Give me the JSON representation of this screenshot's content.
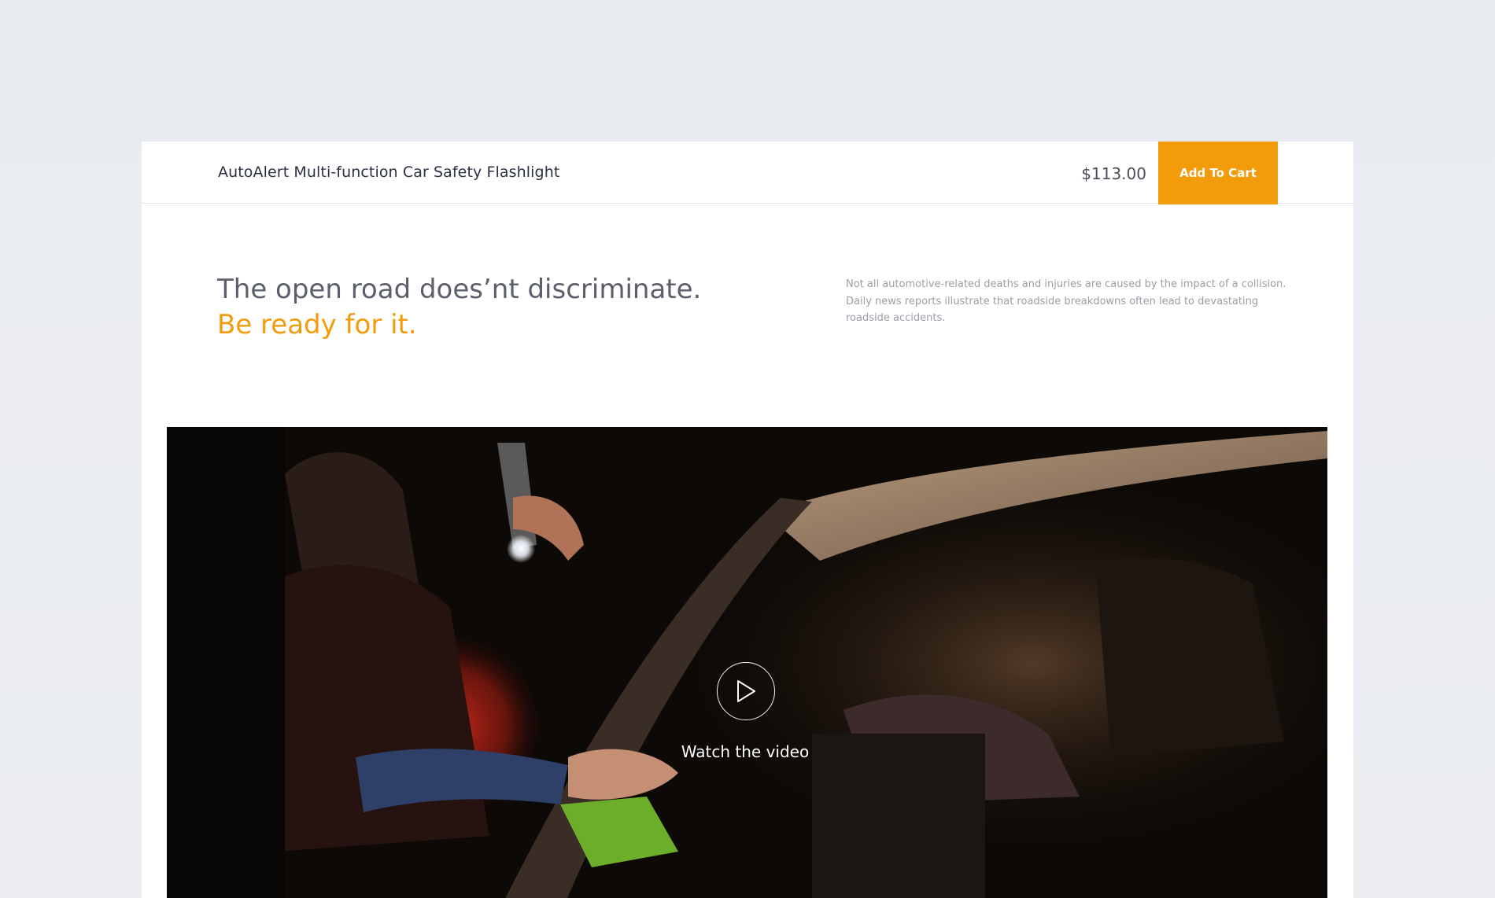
{
  "header": {
    "product_name": "AutoAlert Multi-function Car Safety Flashlight",
    "price": "$113.00",
    "cart_button": "Add To Cart"
  },
  "hero": {
    "headline": "The open road does’nt discriminate.",
    "headline_accent": "Be ready for it.",
    "description": "Not all automotive-related deaths and injuries are caused by the impact of a collision. Daily news reports illustrate that roadside breakdowns often lead to devastating roadside accidents."
  },
  "video": {
    "play_icon": "play-icon",
    "caption": "Watch the video"
  },
  "colors": {
    "accent": "#f39c0b",
    "page_background": "#e9ecf0",
    "card_background": "#ffffff",
    "text_primary": "#2b3142",
    "text_headline": "#5b5f69",
    "text_muted": "#9a9ea6"
  }
}
